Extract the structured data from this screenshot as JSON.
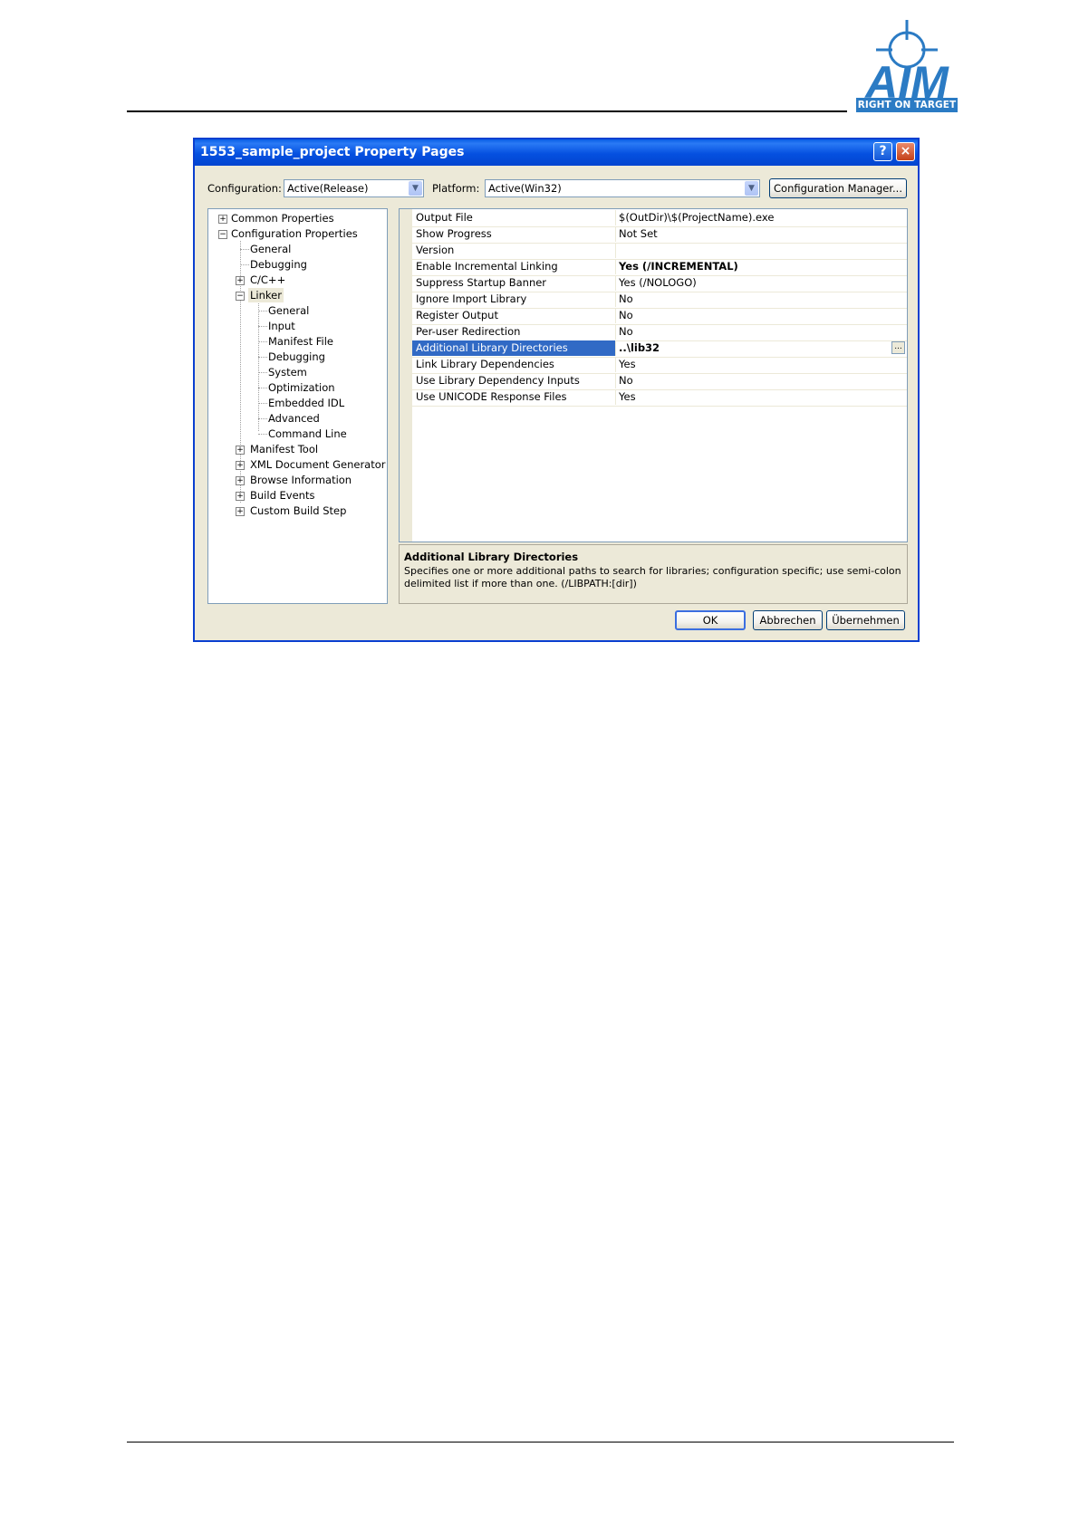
{
  "page": {
    "logo": {
      "word": "AIM",
      "tagline": "RIGHT ON TARGET",
      "color": "#2b7bc4"
    }
  },
  "dialog": {
    "title": "1553_sample_project Property Pages",
    "help_glyph": "?",
    "close_glyph": "×",
    "configuration_label": "Configuration:",
    "configuration_value": "Active(Release)",
    "platform_label": "Platform:",
    "platform_value": "Active(Win32)",
    "config_manager_label": "Configuration Manager...",
    "tree": [
      {
        "label": "Common Properties",
        "expander": "+"
      },
      {
        "label": "Configuration Properties",
        "expander": "−"
      },
      {
        "label": "General"
      },
      {
        "label": "Debugging"
      },
      {
        "label": "C/C++",
        "expander": "+"
      },
      {
        "label": "Linker",
        "expander": "−",
        "selected": true
      },
      {
        "label": "General"
      },
      {
        "label": "Input"
      },
      {
        "label": "Manifest File"
      },
      {
        "label": "Debugging"
      },
      {
        "label": "System"
      },
      {
        "label": "Optimization"
      },
      {
        "label": "Embedded IDL"
      },
      {
        "label": "Advanced"
      },
      {
        "label": "Command Line"
      },
      {
        "label": "Manifest Tool",
        "expander": "+"
      },
      {
        "label": "XML Document Generator",
        "expander": "+"
      },
      {
        "label": "Browse Information",
        "expander": "+"
      },
      {
        "label": "Build Events",
        "expander": "+"
      },
      {
        "label": "Custom Build Step",
        "expander": "+"
      }
    ],
    "properties": [
      {
        "name": "Output File",
        "value": "$(OutDir)\\$(ProjectName).exe"
      },
      {
        "name": "Show Progress",
        "value": "Not Set"
      },
      {
        "name": "Version",
        "value": ""
      },
      {
        "name": "Enable Incremental Linking",
        "value": "Yes (/INCREMENTAL)",
        "bold": true
      },
      {
        "name": "Suppress Startup Banner",
        "value": "Yes (/NOLOGO)"
      },
      {
        "name": "Ignore Import Library",
        "value": "No"
      },
      {
        "name": "Register Output",
        "value": "No"
      },
      {
        "name": "Per-user Redirection",
        "value": "No"
      },
      {
        "name": "Additional Library Directories",
        "value": "..\\lib32",
        "bold": true,
        "selected": true
      },
      {
        "name": "Link Library Dependencies",
        "value": "Yes"
      },
      {
        "name": "Use Library Dependency Inputs",
        "value": "No"
      },
      {
        "name": "Use UNICODE Response Files",
        "value": "Yes"
      }
    ],
    "ellipsis_label": "...",
    "description": {
      "title": "Additional Library Directories",
      "text": "Specifies one or more additional paths to search for libraries; configuration specific; use semi-colon delimited list if more than one.     (/LIBPATH:[dir])"
    },
    "buttons": {
      "ok": "OK",
      "cancel": "Abbrechen",
      "apply": "Übernehmen"
    }
  }
}
